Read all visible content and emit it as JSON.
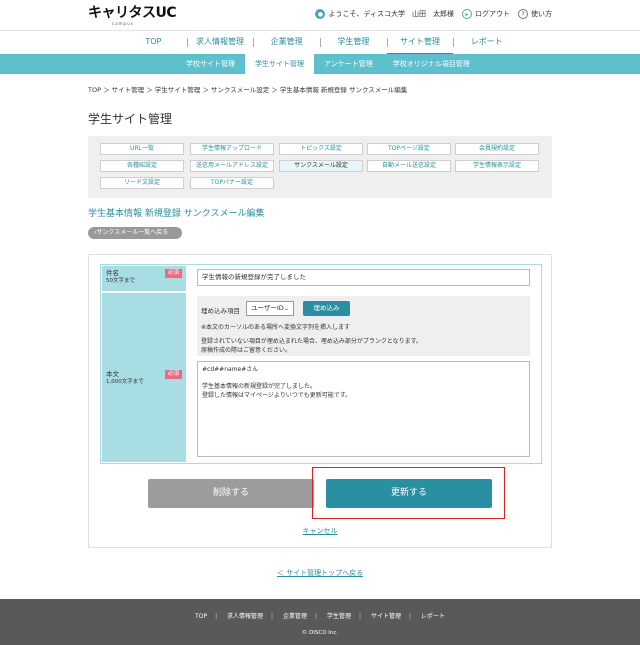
{
  "header": {
    "logo": "キャリタスUC",
    "logo_sub": "campus",
    "greeting": "ようこそ、ディスコ大学　山田　太郎様",
    "logout": "ログアウト",
    "help": "使い方"
  },
  "main_nav": [
    "TOP",
    "求人情報管理",
    "企業管理",
    "学生管理",
    "サイト管理",
    "レポート"
  ],
  "sub_nav": [
    "学校サイト管理",
    "学生サイト管理",
    "アンケート管理",
    "学校オリジナル項目管理"
  ],
  "breadcrumb": "TOP ＞ サイト管理 ＞ 学生サイト管理 ＞ サンクスメール設定 ＞ 学生基本情報 新規登録 サンクスメール編集",
  "page_title": "学生サイト管理",
  "tabs": [
    "URL一覧",
    "学生情報アップロード",
    "トピックス設定",
    "TOPページ設定",
    "会員規約設定",
    "各種紹設定",
    "送信用メールアドレス設定",
    "サンクスメール設定",
    "自動メール送信設定",
    "学生情報表示設定",
    "リード文設定",
    "TOPバナー設定"
  ],
  "section_title": "学生基本情報 新規登録 サンクスメール編集",
  "back_button": "サンクスメール一覧へ戻る",
  "form": {
    "subject_label": "件名",
    "subject_limit": "50文字まで",
    "required": "必須",
    "subject_value": "学生情報の新規登録が完了しました",
    "body_label": "本文",
    "body_limit": "1,000文字まで",
    "embed_label": "埋め込み項目",
    "embed_select": "ユーザーID",
    "embed_button": "埋め込み",
    "note1": "※本文のカーソルのある場所へ変換文字列を挿入します",
    "note2": "登録されていない項目が埋め込まれた場合、埋め込み部分がブランクとなります。",
    "note3": "原稿作成の際はご留意ください。",
    "body_line1": "#cd##name#さん",
    "body_line2": "",
    "body_line3": "学生基本情報の新規登録が完了しました。",
    "body_line4": "登録した情報はマイページよりいつでも更新可能です。"
  },
  "buttons": {
    "delete": "削除する",
    "update": "更新する",
    "cancel": "キャンセル",
    "back_top": "＜ サイト管理トップへ戻る"
  },
  "footer": {
    "links": [
      "TOP",
      "求人情報管理",
      "企業管理",
      "学生管理",
      "サイト管理",
      "レポート"
    ],
    "copyright": "© DISCO Inc."
  },
  "colors": {
    "accent": "#2a8fa0",
    "subnav": "#5fc0cd",
    "required": "#ea6a7f",
    "footer": "#595959"
  }
}
